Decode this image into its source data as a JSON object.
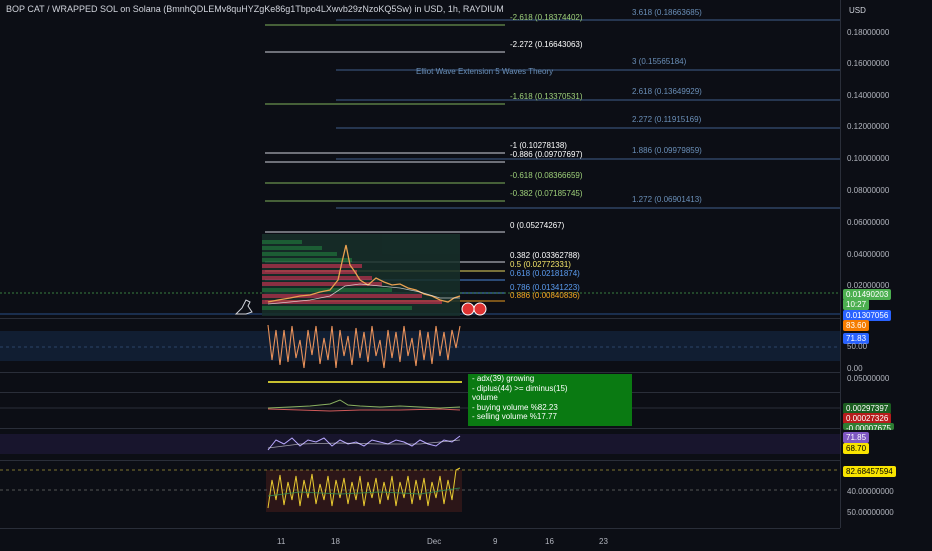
{
  "header": {
    "title": "BOP CAT / WRAPPED SOL on Solana (BmnhQDLEMv8quHYZgKe86g1Tbpo4LXwvb29zNzoKQ5Sw) in USD, 1h, RAYDIUM"
  },
  "price_scale": {
    "currency": "USD",
    "ticks": [
      "0.18000000",
      "0.16000000",
      "0.14000000",
      "0.12000000",
      "0.10000000",
      "0.08000000",
      "0.06000000",
      "0.04000000",
      "0.02000000"
    ],
    "last_price": "0.01490203",
    "countdown": "10:27",
    "price_tag_2": "0.01307056",
    "ind1_value_a": "83.60",
    "ind1_value_b": "71.83",
    "ind1_tick": "50.00",
    "ind2_tick_a": "0.00",
    "ind2_tick_b": "0.05000000",
    "ind3_value_a": "0.00297397",
    "ind3_value_b": "0.00027326",
    "ind3_value_c": "-0.00007675",
    "ind4_value_a": "71.85",
    "ind4_value_b": "68.70",
    "ind5_value_a": "82.68457594",
    "ind5_tick_a": "40.00000000",
    "ind5_tick_b": "50.00000000"
  },
  "fib_left": [
    {
      "label": "-2.618 (0.18374402)",
      "color": "#9fd17a"
    },
    {
      "label": "-2.272 (0.16643063)",
      "color": "#ffffff"
    },
    {
      "label": "-1.618 (0.13370531)",
      "color": "#9fd17a"
    },
    {
      "label": "-1 (0.10278138)",
      "color": "#ffffff"
    },
    {
      "label": "-0.886 (0.09707697)",
      "color": "#ffffff"
    },
    {
      "label": "-0.618 (0.08366659)",
      "color": "#9fd17a"
    },
    {
      "label": "-0.382 (0.07185745)",
      "color": "#9fd17a"
    },
    {
      "label": "0 (0.05274267)",
      "color": "#ffffff"
    },
    {
      "label": "0.382 (0.03362788)",
      "color": "#ffffff"
    },
    {
      "label": "0.5 (0.02772331)",
      "color": "#f5e66a"
    },
    {
      "label": "0.618 (0.02181874)",
      "color": "#5b9cf0"
    },
    {
      "label": "0.786 (0.01341223)",
      "color": "#5b9cf0"
    },
    {
      "label": "0.886 (0.00840836)",
      "color": "#f5a623"
    }
  ],
  "fib_right": [
    {
      "label": "3.618 (0.18663685)",
      "color": "#6a8fb8"
    },
    {
      "label": "3 (0.15565184)",
      "color": "#6a8fb8"
    },
    {
      "label": "2.618 (0.13649929)",
      "color": "#6a8fb8"
    },
    {
      "label": "2.272 (0.11915169)",
      "color": "#6a8fb8"
    },
    {
      "label": "1.886 (0.09979859)",
      "color": "#6a8fb8"
    },
    {
      "label": "1.272 (0.06901413)",
      "color": "#6a8fb8"
    }
  ],
  "elliot_label": "Elliot Wave Extension 5 Waves Theory",
  "note": {
    "lines": [
      " - adx(39) growing",
      " - diplus(44) >= diminus(15)",
      "",
      "volume",
      " - buying volume %82.23",
      " - selling volume %17.77"
    ]
  },
  "time_axis": {
    "labels": [
      "11",
      "18",
      "Dec",
      "9",
      "16",
      "23"
    ]
  },
  "colors": {
    "accent_green": "#0a7a12",
    "candle_up": "#26a69a",
    "candle_down": "#ef5350",
    "price_green": "#4caf50"
  }
}
